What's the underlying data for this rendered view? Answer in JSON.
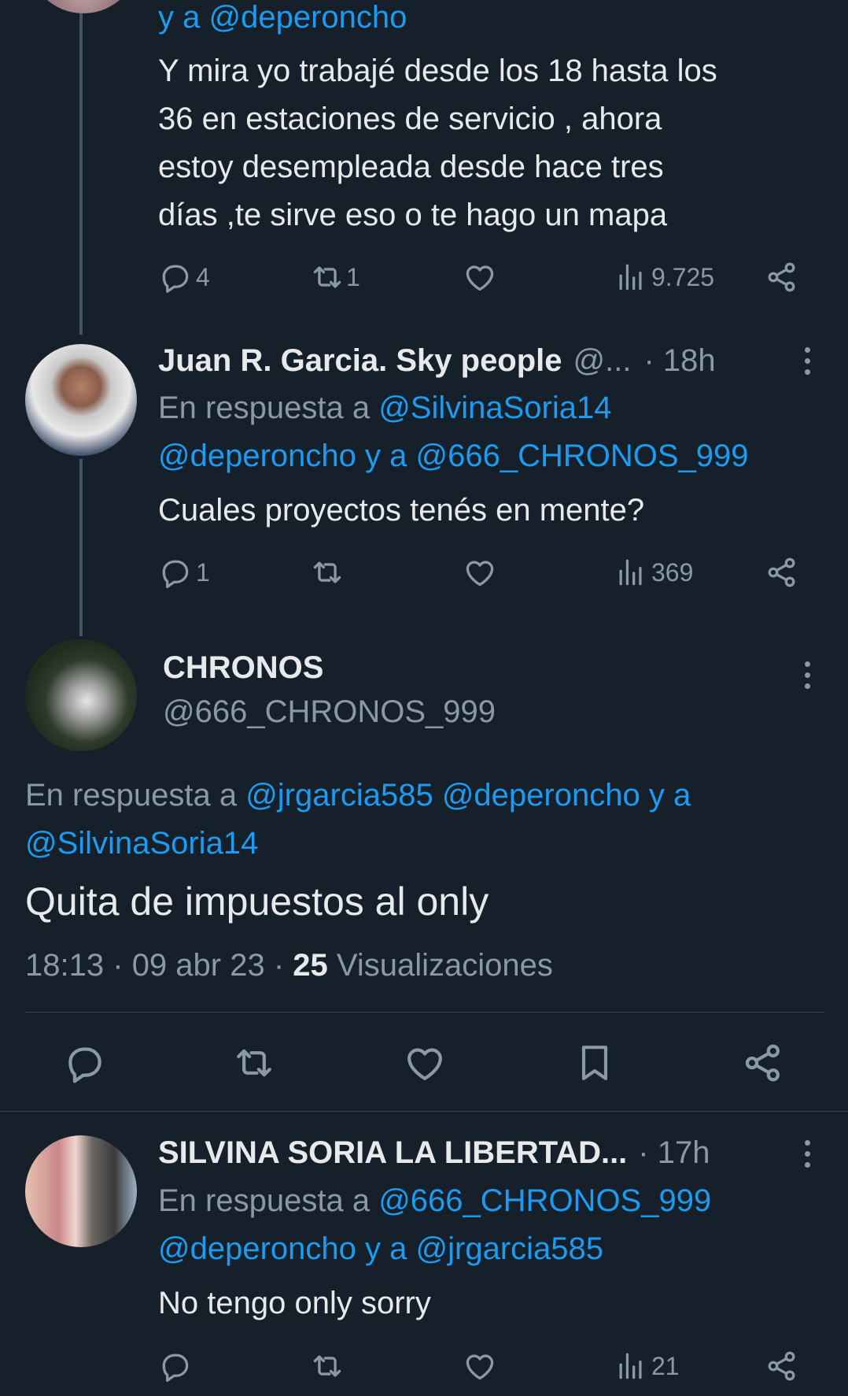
{
  "reply1": {
    "mention_tail": "y a @deperoncho",
    "text": "Y mira yo trabajé desde los 18 hasta los 36 en estaciones de servicio , ahora estoy desempleada desde hace tres días ,te sirve eso o te hago un mapa",
    "lines": [
      "Y mira yo trabajé desde los 18 hasta los",
      "36 en estaciones de servicio , ahora",
      "estoy desempleada desde hace tres",
      "días ,te sirve eso o te hago un mapa"
    ],
    "replies": "4",
    "retweets": "1",
    "views": "9.725"
  },
  "reply2": {
    "name": "Juan R. Garcia. Sky people",
    "handle_truncated": "@...",
    "time": "· 18h",
    "reply_prefix": "En respuesta a",
    "mention1": "@SilvinaSoria14",
    "mention2": "@deperoncho",
    "and": "y a",
    "mention3": "@666_CHRONOS_999",
    "text": "Cuales proyectos tenés en mente?",
    "replies": "1",
    "views": "369"
  },
  "main": {
    "name": "CHRONOS",
    "handle": "@666_CHRONOS_999",
    "reply_prefix": "En respuesta a",
    "mention1": "@jrgarcia585",
    "mention2": "@deperoncho",
    "and": "y a",
    "mention3": "@SilvinaSoria14",
    "text": "Quita de impuestos al only",
    "time": "18:13",
    "sep": "·",
    "date": "09 abr 23",
    "views_count": "25",
    "views_label": "Visualizaciones"
  },
  "reply3": {
    "name": "SILVINA SORIA LA LIBERTAD...",
    "time": "· 17h",
    "reply_prefix": "En respuesta a",
    "mention1": "@666_CHRONOS_999",
    "mention2": "@deperoncho",
    "and": "y a",
    "mention3": "@jrgarcia585",
    "text": "No tengo only sorry",
    "views": "21"
  },
  "colors": {
    "background": "#15202b",
    "link": "#1d9bf0",
    "muted": "#8b98a5",
    "text": "#e7e9ea"
  },
  "icons": [
    "reply-icon",
    "retweet-icon",
    "like-icon",
    "views-icon",
    "share-icon",
    "bookmark-icon",
    "more-icon"
  ]
}
